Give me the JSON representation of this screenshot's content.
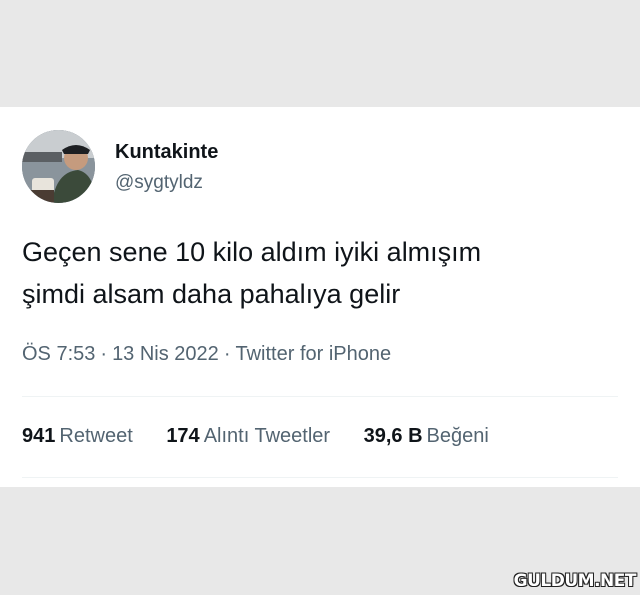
{
  "tweet": {
    "author_name": "Kuntakinte",
    "author_handle": "@sygtyldz",
    "text_line1": "Geçen sene 10 kilo aldım iyiki almışım",
    "text_line2": "şimdi alsam daha pahalıya gelir",
    "time": "ÖS 7:53",
    "date": "13 Nis 2022",
    "source": "Twitter for iPhone",
    "separator": "·"
  },
  "stats": {
    "retweets_count": "941",
    "retweets_label": "Retweet",
    "quotes_count": "174",
    "quotes_label": "Alıntı Tweetler",
    "likes_count": "39,6 B",
    "likes_label": "Beğeni"
  },
  "watermark": {
    "text": "GULDUM.NET"
  },
  "colors": {
    "background": "#e8e8e8",
    "card": "#ffffff",
    "primary_text": "#0f1419",
    "secondary_text": "#536471"
  }
}
